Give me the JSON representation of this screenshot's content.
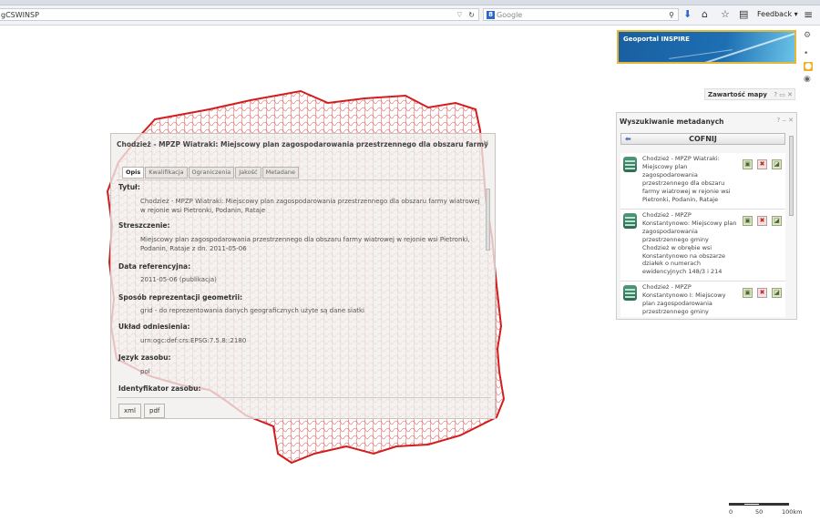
{
  "browser": {
    "url": "gCSWINSP",
    "search_placeholder": "Google",
    "feedback_label": "Feedback"
  },
  "colors": {
    "border_red": "#d11d1d",
    "accent_blue": "#1d6fb3",
    "accent_gold": "#e2b73a"
  },
  "icons": {
    "reload": "↻",
    "search": "⚲",
    "download": "⬇",
    "home": "⌂",
    "star": "☆",
    "clipboard": "▤",
    "menu": "≡",
    "close": "✕",
    "back": "⬅",
    "launch": "▣",
    "remove": "✖",
    "export": "◪",
    "settings": "⚙",
    "dot": "•",
    "active": "●",
    "eye": "◉"
  },
  "geoportal": {
    "title": "Geoportal INSPIRE"
  },
  "map_contents": {
    "label": "Zawartość mapy",
    "controls": "? ▭ ✕"
  },
  "metadata_panel": {
    "title": "Wyszukiwanie metadanych",
    "controls": "? ‒ ✕",
    "back_label": "COFNIJ",
    "results": [
      {
        "text": "Chodzież - MPZP Wiatraki: Miejscowy plan zagospodarowania przestrzennego dla obszaru farmy wiatrowej w rejonie wsi Pietronki, Podanin, Rataje"
      },
      {
        "text": "Chodzież - MPZP Konstantynowo: Miejscowy plan zagospodarowania przestrzennego gminy Chodzież w obrębie wsi Konstantynowo na obszarze działek o numerach ewidencyjnych 148/3 i 214"
      },
      {
        "text": "Chodzież - MPZP Konstantynowo I: Miejscowy plan zagospodarowania przestrzennego gminy"
      }
    ]
  },
  "dialog": {
    "title": "Chodzież - MPZP Wiatraki: Miejscowy plan zagospodarowania przestrzennego dla obszaru farmy",
    "tabs": [
      "Opis",
      "Kwalifikacja",
      "Ograniczenia",
      "Jakość",
      "Metadane"
    ],
    "fields": [
      {
        "label": "Tytuł:",
        "value": "Chodzież - MPZP Wiatraki: Miejscowy plan zagospodarowania przestrzennego dla obszaru farmy wiatrowej w rejonie wsi Pietronki, Podanin, Rataje"
      },
      {
        "label": "Streszczenie:",
        "value": "Miejscowy plan zagospodarowania przestrzennego dla obszaru farmy wiatrowej w rejonie wsi Pietronki, Podanin, Rataje z dn. 2011-05-06"
      },
      {
        "label": "Data referencyjna:",
        "value": "2011-05-06 (publikacja)"
      },
      {
        "label": "Sposób reprezentacji geometrii:",
        "value": "grid - do reprezentowania danych geograficznych użyte są dane siatki"
      },
      {
        "label": "Układ odniesienia:",
        "value": "urn:ogc:def:crs:EPSG:7.5.8::2180"
      },
      {
        "label": "Język zasobu:",
        "value": "pol"
      },
      {
        "label": "Identyfikator zasobu:",
        "value": ""
      }
    ],
    "buttons": {
      "xml": "xml",
      "pdf": "pdf"
    }
  },
  "scale": {
    "labels": [
      "0",
      "50",
      "100km"
    ]
  }
}
